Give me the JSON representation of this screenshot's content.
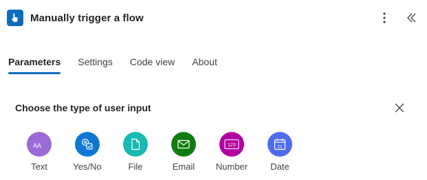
{
  "header": {
    "title": "Manually trigger a flow",
    "icon": "hand-pointer-icon",
    "accent": "#0f6cbd"
  },
  "tabs": [
    {
      "label": "Parameters",
      "active": true
    },
    {
      "label": "Settings",
      "active": false
    },
    {
      "label": "Code view",
      "active": false
    },
    {
      "label": "About",
      "active": false
    }
  ],
  "section": {
    "title": "Choose the type of user input"
  },
  "input_types": [
    {
      "label": "Text",
      "icon": "text-icon",
      "color": "#9c6ad6",
      "glyph": "AA"
    },
    {
      "label": "Yes/No",
      "icon": "yes-no-icon",
      "color": "#0f78d4"
    },
    {
      "label": "File",
      "icon": "file-icon",
      "color": "#1ab9b2"
    },
    {
      "label": "Email",
      "icon": "email-icon",
      "color": "#107c10"
    },
    {
      "label": "Number",
      "icon": "number-icon",
      "color": "#b4009e",
      "glyph": "123"
    },
    {
      "label": "Date",
      "icon": "calendar-icon",
      "color": "#4f6bed",
      "glyph": "21"
    }
  ]
}
